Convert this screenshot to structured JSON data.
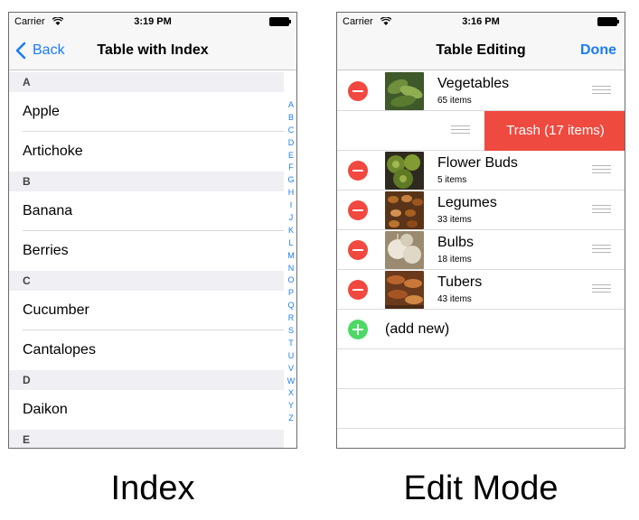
{
  "index_screen": {
    "status": {
      "carrier": "Carrier",
      "time": "3:19 PM"
    },
    "nav": {
      "back_label": "Back",
      "title": "Table with Index"
    },
    "sections": [
      {
        "header": "A",
        "rows": [
          "Apple",
          "Artichoke"
        ]
      },
      {
        "header": "B",
        "rows": [
          "Banana",
          "Berries"
        ]
      },
      {
        "header": "C",
        "rows": [
          "Cucumber",
          "Cantalopes"
        ]
      },
      {
        "header": "D",
        "rows": [
          "Daikon"
        ]
      },
      {
        "header": "E",
        "rows": []
      }
    ],
    "index_letters": [
      "A",
      "B",
      "C",
      "D",
      "E",
      "F",
      "G",
      "H",
      "I",
      "J",
      "K",
      "L",
      "M",
      "N",
      "O",
      "P",
      "Q",
      "R",
      "S",
      "T",
      "U",
      "V",
      "W",
      "X",
      "Y",
      "Z"
    ]
  },
  "edit_screen": {
    "status": {
      "carrier": "Carrier",
      "time": "3:16 PM"
    },
    "nav": {
      "title": "Table Editing",
      "done_label": "Done"
    },
    "rows": [
      {
        "name": "Vegetables",
        "count": "65 items"
      },
      {
        "name": "Flower Buds",
        "count": "5 items"
      },
      {
        "name": "Legumes",
        "count": "33 items"
      },
      {
        "name": "Bulbs",
        "count": "18 items"
      },
      {
        "name": "Tubers",
        "count": "43 items"
      }
    ],
    "trash_label": "Trash (17 items)",
    "add_label": "(add new)"
  },
  "captions": {
    "left": "Index",
    "right": "Edit Mode"
  },
  "colors": {
    "accent": "#1a7cf5",
    "delete": "#f1483f",
    "add": "#4cd964",
    "trash": "#ef4a3f"
  }
}
